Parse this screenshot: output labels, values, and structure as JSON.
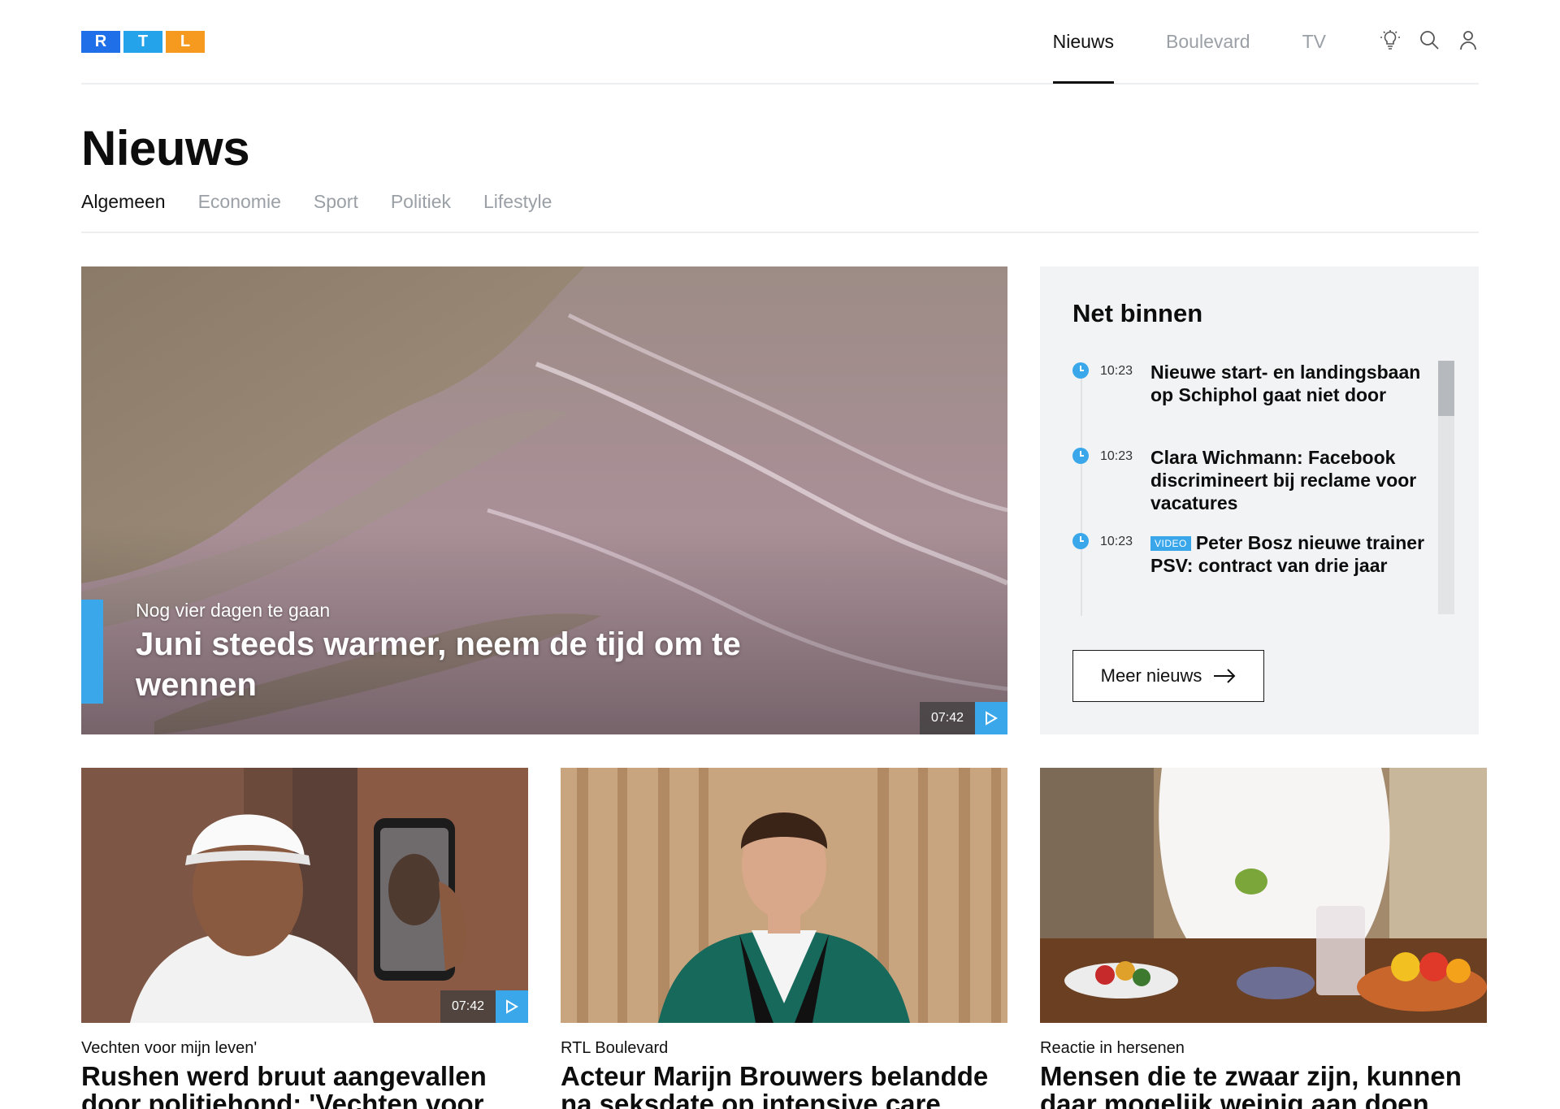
{
  "header": {
    "logo_letters": [
      "R",
      "T",
      "L"
    ],
    "nav": [
      {
        "label": "Nieuws",
        "active": true
      },
      {
        "label": "Boulevard",
        "active": false
      },
      {
        "label": "TV",
        "active": false
      }
    ],
    "icons": [
      "lightbulb-icon",
      "search-icon",
      "user-icon"
    ]
  },
  "page": {
    "title": "Nieuws",
    "subnav": [
      {
        "label": "Algemeen",
        "active": true
      },
      {
        "label": "Economie",
        "active": false
      },
      {
        "label": "Sport",
        "active": false
      },
      {
        "label": "Politiek",
        "active": false
      },
      {
        "label": "Lifestyle",
        "active": false
      }
    ]
  },
  "hero": {
    "kicker": "Nog vier dagen te gaan",
    "title": "Juni steeds warmer, neem de tijd om te wennen",
    "duration": "07:42"
  },
  "net_binnen": {
    "title": "Net binnen",
    "items": [
      {
        "time": "10:23",
        "badge": "",
        "headline": "Nieuwe start- en landingsbaan op Schiphol gaat niet door"
      },
      {
        "time": "10:23",
        "badge": "",
        "headline": "Clara Wichmann: Facebook discrimineert bij reclame voor vacatures"
      },
      {
        "time": "10:23",
        "badge": "VIDEO",
        "headline": "Peter Bosz nieuwe trainer PSV: contract van drie jaar"
      }
    ],
    "button_label": "Meer nieuws"
  },
  "cards": [
    {
      "kicker": "Vechten voor mijn leven'",
      "title": "Rushen werd bruut aangevallen door politiehond: 'Vechten voor mijn leven'",
      "duration": "07:42"
    },
    {
      "kicker": "RTL Boulevard",
      "title": "Acteur Marijn Brouwers belandde na seksdate op intensive care",
      "duration": ""
    },
    {
      "kicker": "Reactie in hersenen",
      "title": "Mensen die te zwaar zijn, kunnen daar mogelijk weinig aan doen",
      "duration": ""
    }
  ],
  "colors": {
    "accent": "#3aa7ea",
    "logo_r": "#1f6fe8",
    "logo_t": "#24a3ea",
    "logo_l": "#f59a1f",
    "panel_bg": "#f2f3f4",
    "muted_text": "#9aa0a6"
  }
}
